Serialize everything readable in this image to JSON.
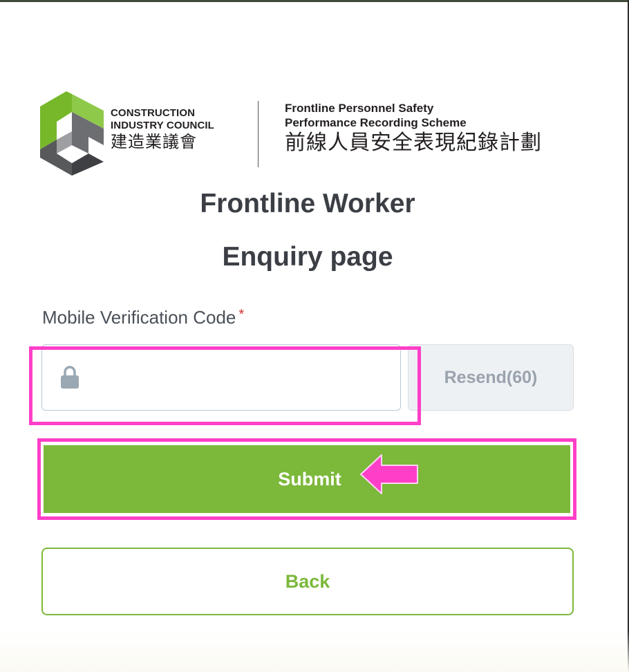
{
  "colors": {
    "brand_green": "#7cb83a",
    "annotation_magenta": "#ff3fc8",
    "required_red": "#d32f2f",
    "title_text": "#3b3f45"
  },
  "logo": {
    "org_en_line1": "CONSTRUCTION",
    "org_en_line2": "INDUSTRY COUNCIL",
    "org_zh": "建造業議會",
    "scheme_en_line1": "Frontline Personnel Safety",
    "scheme_en_line2": "Performance Recording Scheme",
    "scheme_zh": "前線人員安全表現紀錄計劃"
  },
  "page": {
    "title_line1": "Frontline Worker",
    "title_line2": "Enquiry page"
  },
  "form": {
    "code_label": "Mobile Verification Code",
    "required_marker": "*",
    "code_value": "",
    "code_icon": "lock-icon",
    "resend_label": "Resend",
    "resend_countdown": "(60)",
    "submit_label": "Submit",
    "back_label": "Back"
  },
  "annotations": {
    "highlights": [
      "verification-code-input",
      "submit-button"
    ],
    "arrow_icon": "left-arrow-icon"
  }
}
